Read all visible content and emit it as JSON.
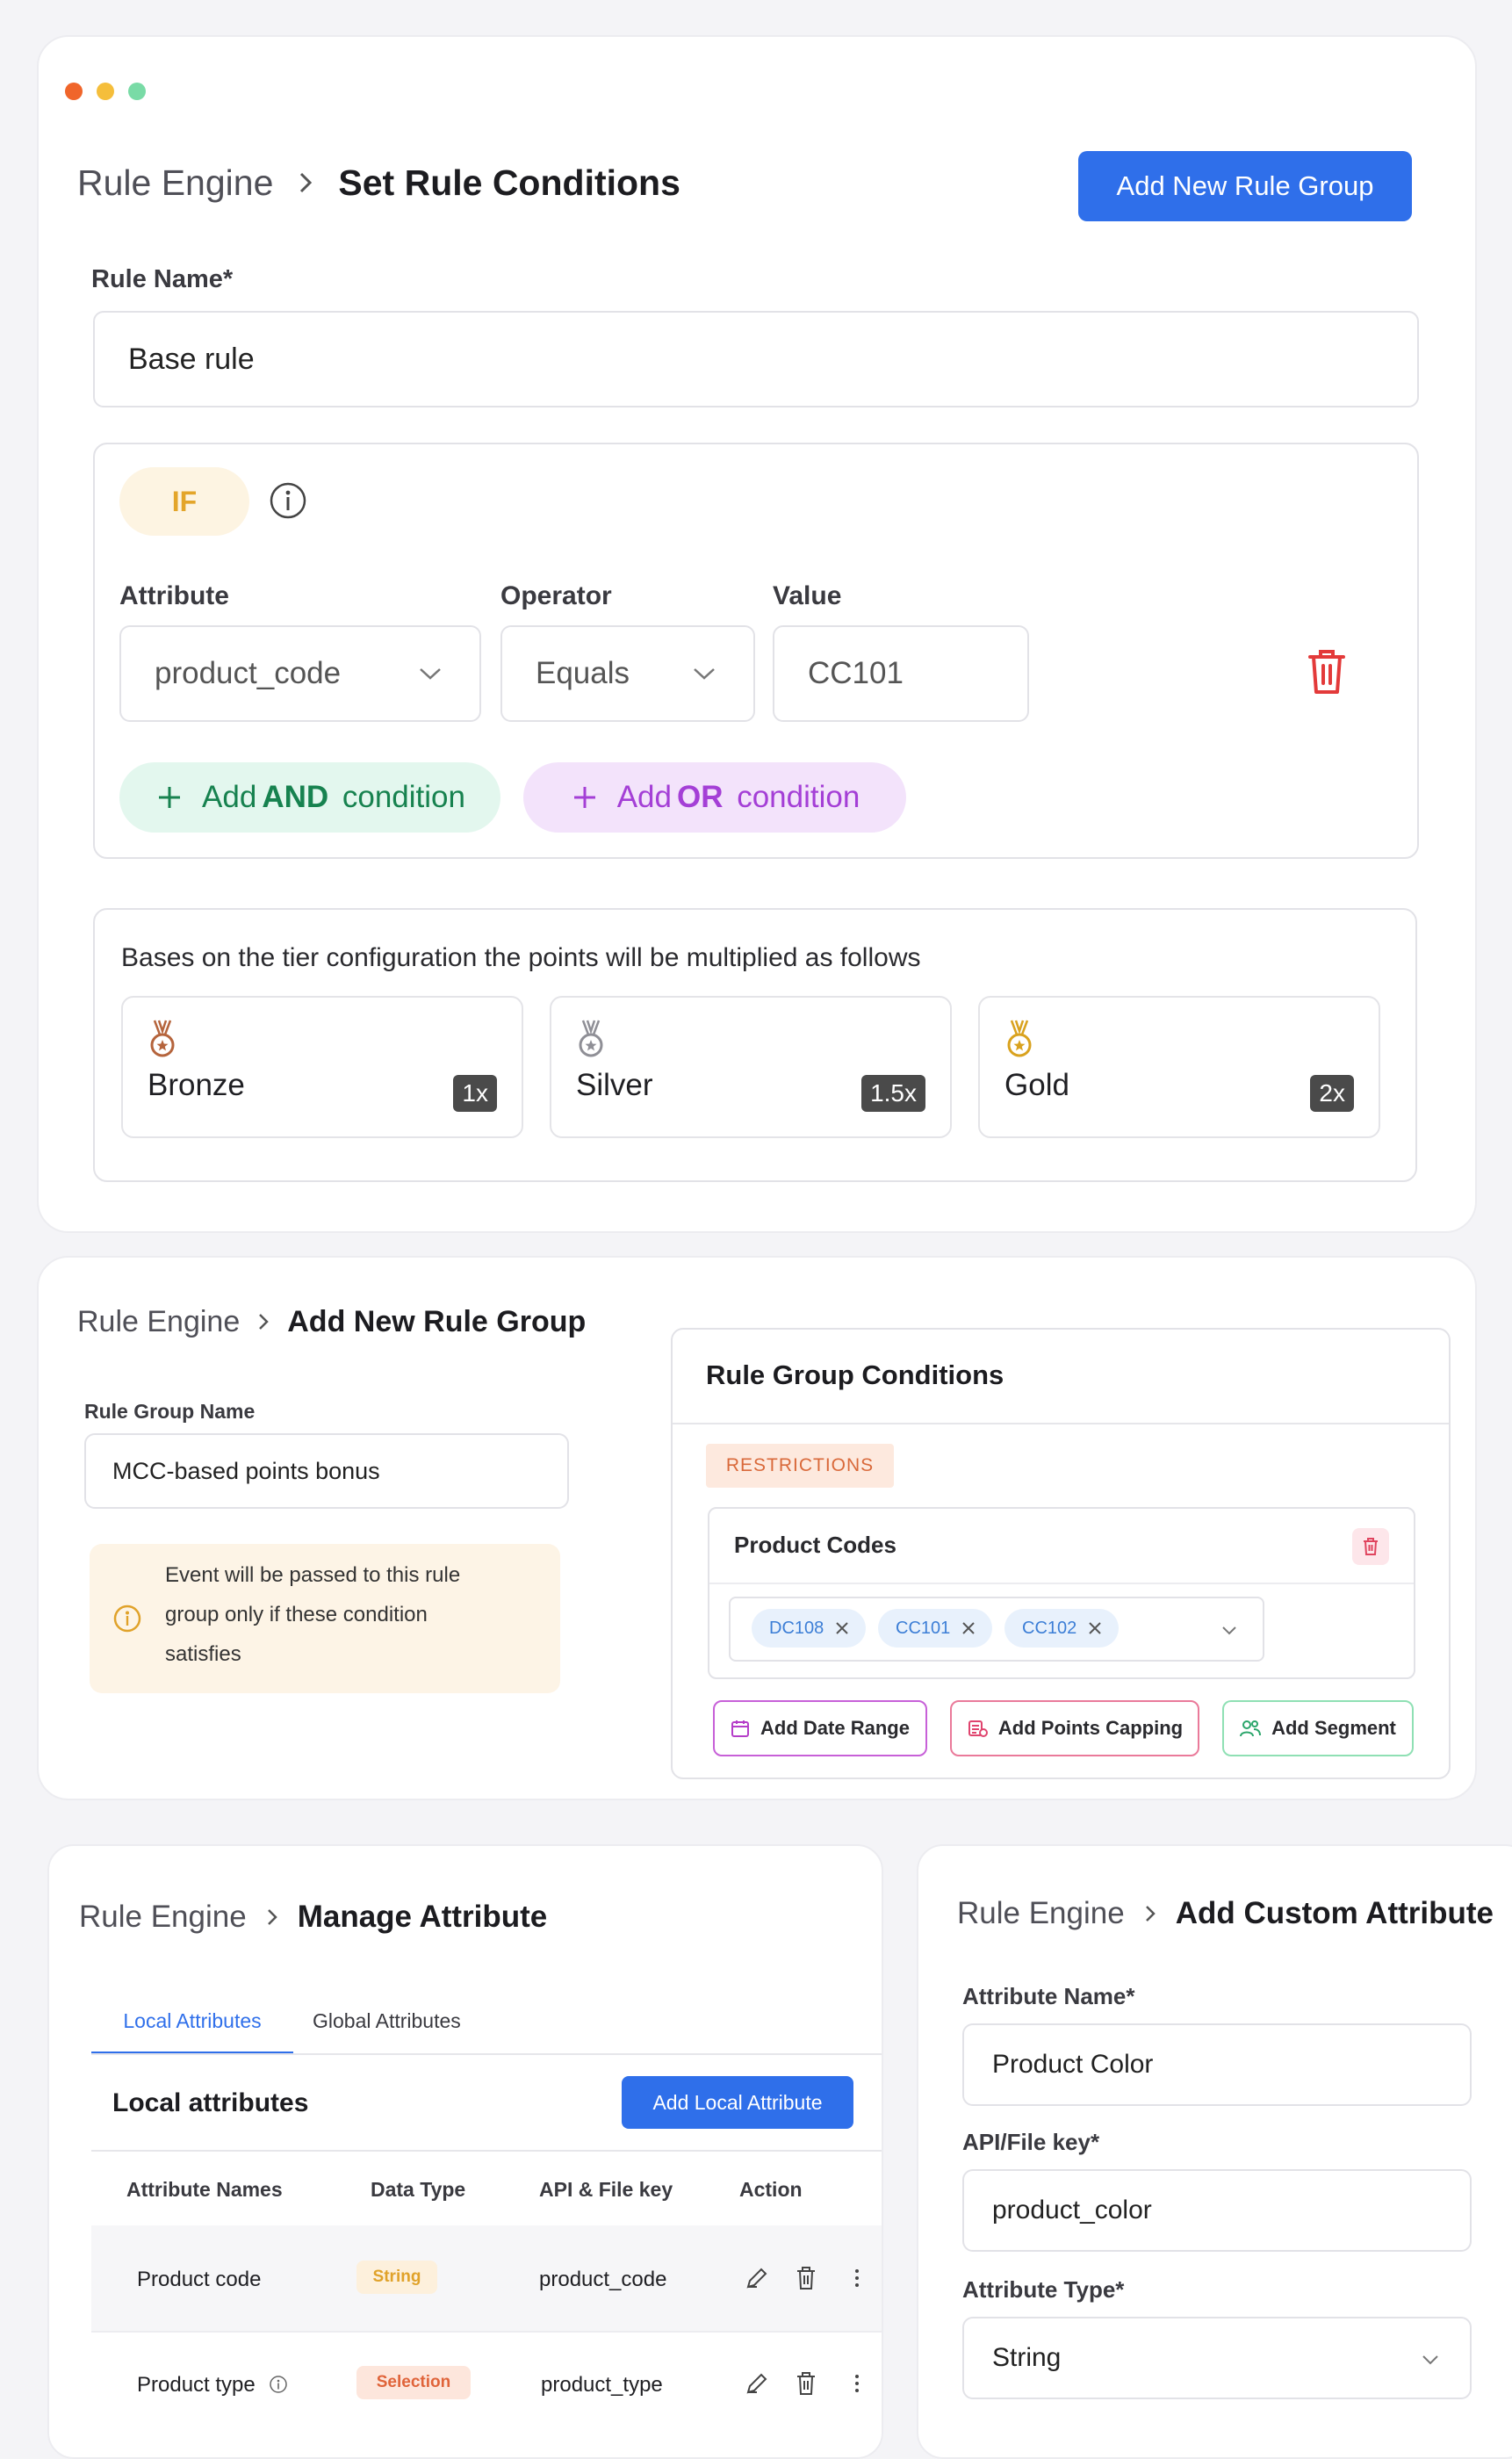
{
  "window": {
    "dots": [
      "#f0652a",
      "#f5be3b",
      "#79dba6"
    ]
  },
  "set_rule": {
    "breadcrumb_root": "Rule Engine",
    "breadcrumb_current": "Set Rule Conditions",
    "add_group_button": "Add New Rule Group",
    "rule_name_label": "Rule Name*",
    "rule_name_value": "Base rule",
    "if_label": "IF",
    "attribute_label": "Attribute",
    "operator_label": "Operator",
    "value_label": "Value",
    "attribute_value": "product_code",
    "operator_value": "Equals",
    "value_value": "CC101",
    "add_and": {
      "prefix": "Add ",
      "keyword": "AND",
      "suffix": " condition"
    },
    "add_or": {
      "prefix": "Add ",
      "keyword": "OR",
      "suffix": " condition"
    },
    "tier_intro": "Bases on the tier configuration the points will be multiplied as follows",
    "tiers": [
      {
        "name": "Bronze",
        "multiplier": "1x",
        "color": "#b5643c"
      },
      {
        "name": "Silver",
        "multiplier": "1.5x",
        "color": "#8f8f96"
      },
      {
        "name": "Gold",
        "multiplier": "2x",
        "color": "#d9a21e"
      }
    ]
  },
  "add_group": {
    "breadcrumb_root": "Rule Engine",
    "breadcrumb_current": "Add New Rule Group",
    "group_name_label": "Rule Group Name",
    "group_name_value": "MCC-based points bonus",
    "notice_lines": [
      "Event will be passed to this rule",
      "group only if these condition",
      "satisfies"
    ],
    "conditions_title": "Rule Group Conditions",
    "restrictions_badge": "RESTRICTIONS",
    "product_codes_title": "Product Codes",
    "chips": [
      "DC108",
      "CC101",
      "CC102"
    ],
    "add_date_range": "Add Date Range",
    "add_points_capping": "Add Points Capping",
    "add_segment": "Add Segment"
  },
  "manage_attr": {
    "breadcrumb_root": "Rule Engine",
    "breadcrumb_current": "Manage Attribute",
    "tabs": [
      "Local Attributes",
      "Global Attributes"
    ],
    "section_title": "Local attributes",
    "add_local_button": "Add Local Attribute",
    "columns": [
      "Attribute Names",
      "Data Type",
      "API & File key",
      "Action"
    ],
    "rows": [
      {
        "name": "Product code",
        "type": "String",
        "key": "product_code"
      },
      {
        "name": "Product type",
        "type": "Selection",
        "key": "product_type"
      }
    ]
  },
  "custom_attr": {
    "breadcrumb_root": "Rule Engine",
    "breadcrumb_current": "Add Custom Attribute",
    "name_label": "Attribute Name*",
    "name_value": "Product Color",
    "key_label": "API/File key*",
    "key_value": "product_color",
    "type_label": "Attribute Type*",
    "type_value": "String"
  }
}
